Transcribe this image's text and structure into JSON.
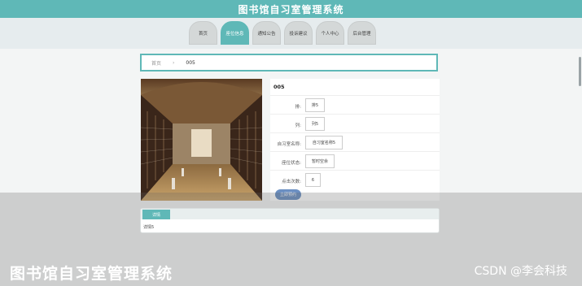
{
  "header": {
    "title": "图书馆自习室管理系统"
  },
  "nav": {
    "items": [
      {
        "label": "首页"
      },
      {
        "label": "座位信息"
      },
      {
        "label": "通知公告"
      },
      {
        "label": "投诉建议"
      },
      {
        "label": "个人中心"
      },
      {
        "label": "后台管理"
      }
    ],
    "active_index": 1
  },
  "breadcrumb": {
    "home": "首页",
    "separator": "›",
    "current": "005"
  },
  "detail": {
    "heading": "005",
    "fields": [
      {
        "label": "排:",
        "value": "排5"
      },
      {
        "label": "列:",
        "value": "列5"
      },
      {
        "label": "自习室名称:",
        "value": "自习室名称5"
      },
      {
        "label": "座位状态:",
        "value": "暂时空余"
      },
      {
        "label": "点击次数:",
        "value": "6"
      }
    ],
    "button_label": "立即预约"
  },
  "tabs": {
    "active": "详情",
    "content": "详情5"
  },
  "watermarks": {
    "left": "图书馆自习室管理系统",
    "right": "CSDN @李会科技"
  },
  "colors": {
    "primary": "#5fb8b7",
    "button": "#6b8fc2"
  }
}
